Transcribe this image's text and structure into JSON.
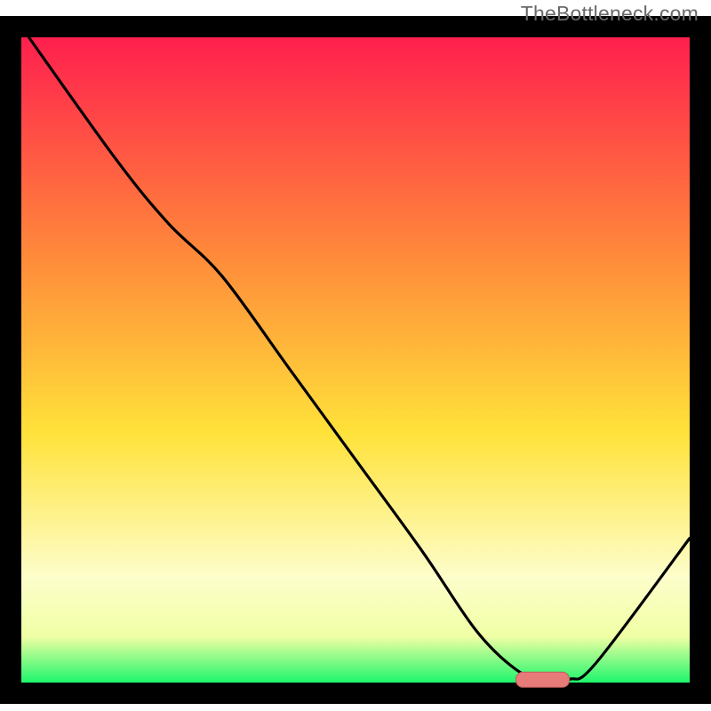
{
  "watermark": "TheBottleneck.com",
  "colors": {
    "frame": "#000000",
    "curve": "#000000",
    "marker_fill": "#e77b7a",
    "marker_stroke": "#bd5d5c",
    "grad_top": "#ff1a4f",
    "grad_mid1": "#ff8a3a",
    "grad_mid2": "#ffe23a",
    "grad_mid3": "#fdfecb",
    "grad_band": "#f0ffa4",
    "grad_bottom": "#1ef66b"
  },
  "chart_data": {
    "type": "line",
    "title": "",
    "xlabel": "",
    "ylabel": "",
    "xlim": [
      0,
      100
    ],
    "ylim": [
      0,
      100
    ],
    "series": [
      {
        "name": "bottleneck-curve",
        "x": [
          0,
          14,
          22,
          30,
          40,
          50,
          60,
          68,
          74,
          78,
          82,
          86,
          100
        ],
        "y": [
          100,
          80,
          70,
          62,
          48,
          34,
          20,
          8,
          2,
          0.5,
          0.5,
          3,
          22
        ]
      }
    ],
    "marker": {
      "name": "optimal-range",
      "x_start": 74,
      "x_end": 82,
      "y": 0.5
    },
    "background_gradient_vertical": true
  }
}
